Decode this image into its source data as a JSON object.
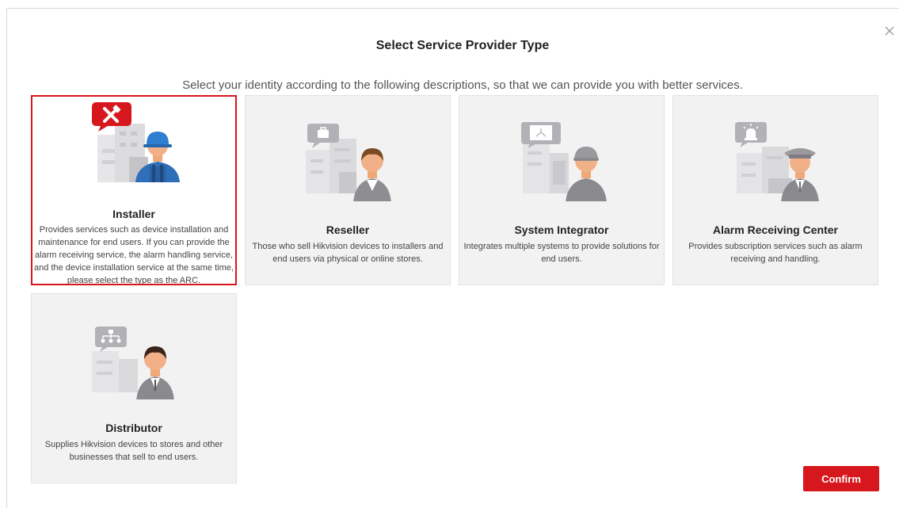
{
  "dialog": {
    "title": "Select Service Provider Type",
    "subtitle": "Select your identity according to the following descriptions, so that we can provide you with better services.",
    "close_icon": "close-icon"
  },
  "cards": [
    {
      "name": "Installer",
      "description": "Provides services such as device installation and maintenance for end users. If you can provide the alarm receiving service, the alarm handling service, and the device installation service at the same time, please select the type as the ARC.",
      "selected": true,
      "icon": "tools-icon"
    },
    {
      "name": "Reseller",
      "description": "Those who sell Hikvision devices to installers and end users via physical or online stores.",
      "selected": false,
      "icon": "briefcase-icon"
    },
    {
      "name": "System Integrator",
      "description": "Integrates multiple systems to provide solutions for end users.",
      "selected": false,
      "icon": "network-icon"
    },
    {
      "name": "Alarm Receiving Center",
      "description": "Provides subscription services such as alarm receiving and handling.",
      "selected": false,
      "icon": "alarm-light-icon"
    },
    {
      "name": "Distributor",
      "description": "Supplies Hikvision devices to stores and other businesses that sell to end users.",
      "selected": false,
      "icon": "hierarchy-icon"
    }
  ],
  "confirm_label": "Confirm",
  "colors": {
    "accent": "#d6171d",
    "card_bg": "#f2f2f3",
    "illustration_gray": "#b0b0b0"
  }
}
